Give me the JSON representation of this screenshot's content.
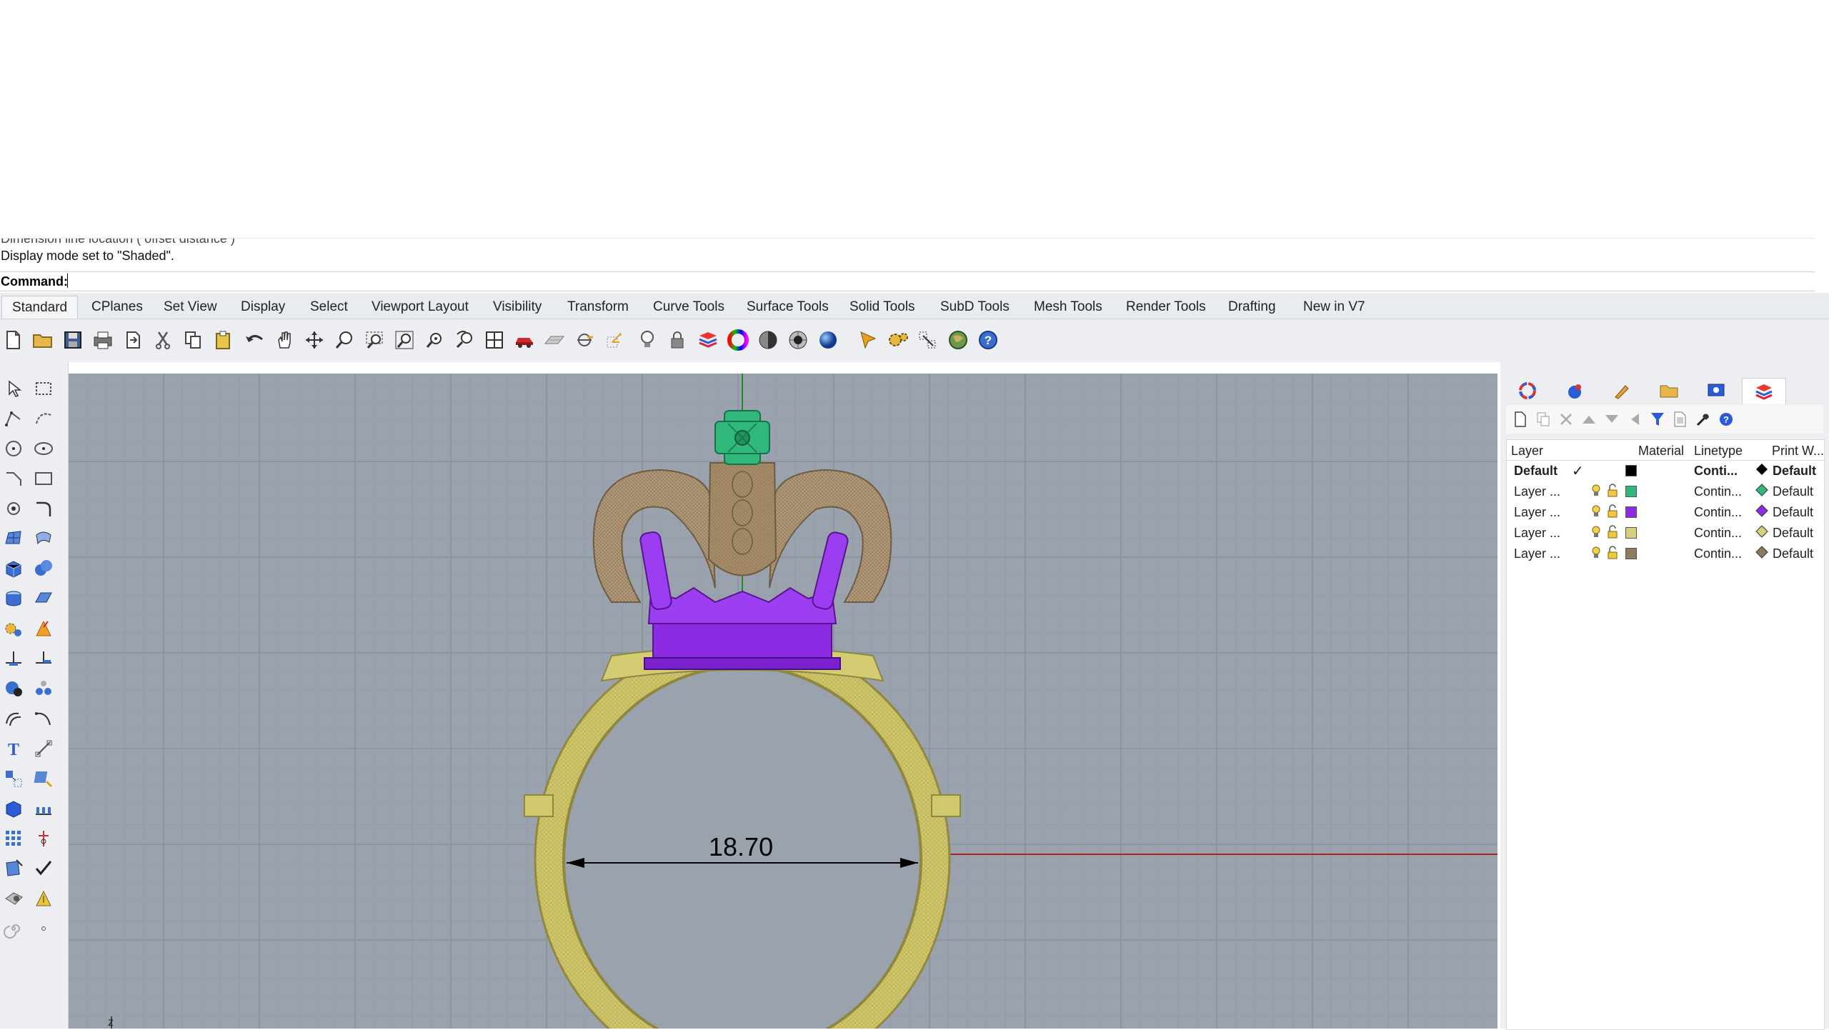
{
  "command": {
    "history": [
      "Dimension line location ( offset distance )",
      "Display mode set to \"Shaded\"."
    ],
    "prompt_label": "Command:",
    "input_value": ""
  },
  "tabs": [
    "Standard",
    "CPlanes",
    "Set View",
    "Display",
    "Select",
    "Viewport Layout",
    "Visibility",
    "Transform",
    "Curve Tools",
    "Surface Tools",
    "Solid Tools",
    "SubD Tools",
    "Mesh Tools",
    "Render Tools",
    "Drafting",
    "New in V7"
  ],
  "active_tab": "Standard",
  "toolbar_icons": [
    "new-icon",
    "open-icon",
    "save-icon",
    "print-icon",
    "import-icon",
    "cut-icon",
    "copy-icon",
    "paste-icon",
    "undo-icon",
    "pan-icon",
    "move-view-icon",
    "zoom-icon",
    "zoom-window-icon",
    "zoom-extents-icon",
    "zoom-selected-icon",
    "rotate-view-icon",
    "four-views-icon",
    "car-icon",
    "cplane-icon",
    "snap-icon",
    "gumball-icon",
    "light-icon",
    "lock-icon",
    "layer-icon",
    "color-wheel-icon",
    "material-sphere-icon",
    "shaded-sphere-icon",
    "render-sphere-icon",
    "filter-icon",
    "settings-gear-icon",
    "dimension-icon",
    "globe-icon",
    "help-icon"
  ],
  "viewport": {
    "dimension_text": "18.70",
    "axis_label": "z"
  },
  "panel_tabs": [
    "properties-color-icon",
    "materials-icon",
    "render-brush-icon",
    "libraries-folder-icon",
    "display-icon",
    "layers-icon"
  ],
  "layers": {
    "headers": {
      "name": "Layer",
      "material": "Material",
      "linetype": "Linetype",
      "print_width": "Print W..."
    },
    "rows": [
      {
        "name": "Default",
        "current_mark": "✓",
        "color": "#000000",
        "linetype": "Conti...",
        "print_width": "Default",
        "pw_color": "#000000",
        "bold": true
      },
      {
        "name": "Layer ...",
        "color": "#2fb87a",
        "linetype": "Contin...",
        "print_width": "Default",
        "pw_color": "#2fb87a",
        "bold": false
      },
      {
        "name": "Layer ...",
        "color": "#8b2be2",
        "linetype": "Contin...",
        "print_width": "Default",
        "pw_color": "#8b2be2",
        "bold": false
      },
      {
        "name": "Layer ...",
        "color": "#d6cf7a",
        "linetype": "Contin...",
        "print_width": "Default",
        "pw_color": "#d6cf7a",
        "bold": false
      },
      {
        "name": "Layer ...",
        "color": "#8e7a5c",
        "linetype": "Contin...",
        "print_width": "Default",
        "pw_color": "#8e7a5c",
        "bold": false
      }
    ]
  }
}
